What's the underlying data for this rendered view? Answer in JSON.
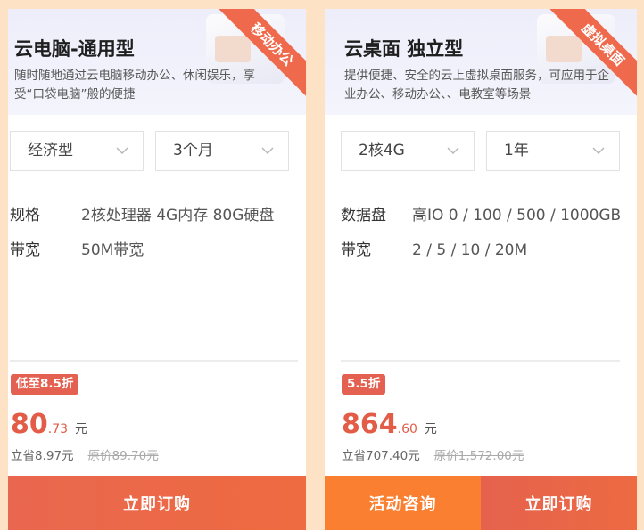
{
  "cards": [
    {
      "ribbon": "移动办公",
      "title": "云电脑-通用型",
      "desc": "随时随地通过云电脑移动办公、休闲娱乐，享受“口袋电脑”般的便捷",
      "select1": "经济型",
      "select2": "3个月",
      "specs": [
        {
          "k": "规格",
          "v": "2核处理器 4G内存 80G硬盘"
        },
        {
          "k": "带宽",
          "v": "50M带宽"
        }
      ],
      "badge": "低至8.5折",
      "price_int": "80",
      "price_dec": ".73",
      "unit": "元",
      "save": "立省8.97元",
      "orig": "原价89.70元",
      "buy": "立即订购"
    },
    {
      "ribbon": "虚拟桌面",
      "title": "云桌面 独立型",
      "desc": "提供便捷、安全的云上虚拟桌面服务，可应用于企业办公、移动办公、、电教室等场景",
      "select1": "2核4G",
      "select2": "1年",
      "specs": [
        {
          "k": "数据盘",
          "v": "高IO 0 / 100 / 500 / 1000GB"
        },
        {
          "k": "带宽",
          "v": "2 / 5 / 10 / 20M"
        }
      ],
      "badge": "5.5折",
      "price_int": "864",
      "price_dec": ".60",
      "unit": "元",
      "save": "立省707.40元",
      "orig": "原价1,572.00元",
      "consult": "活动咨询",
      "buy": "立即订购"
    }
  ],
  "colors": {
    "page_bg": "#fde2c6",
    "accent": "#e25c47",
    "button_orange": "#fb7f30",
    "ribbon": "#ef6a4d"
  },
  "icons": {
    "select_chevron": "chevron-down-icon"
  }
}
